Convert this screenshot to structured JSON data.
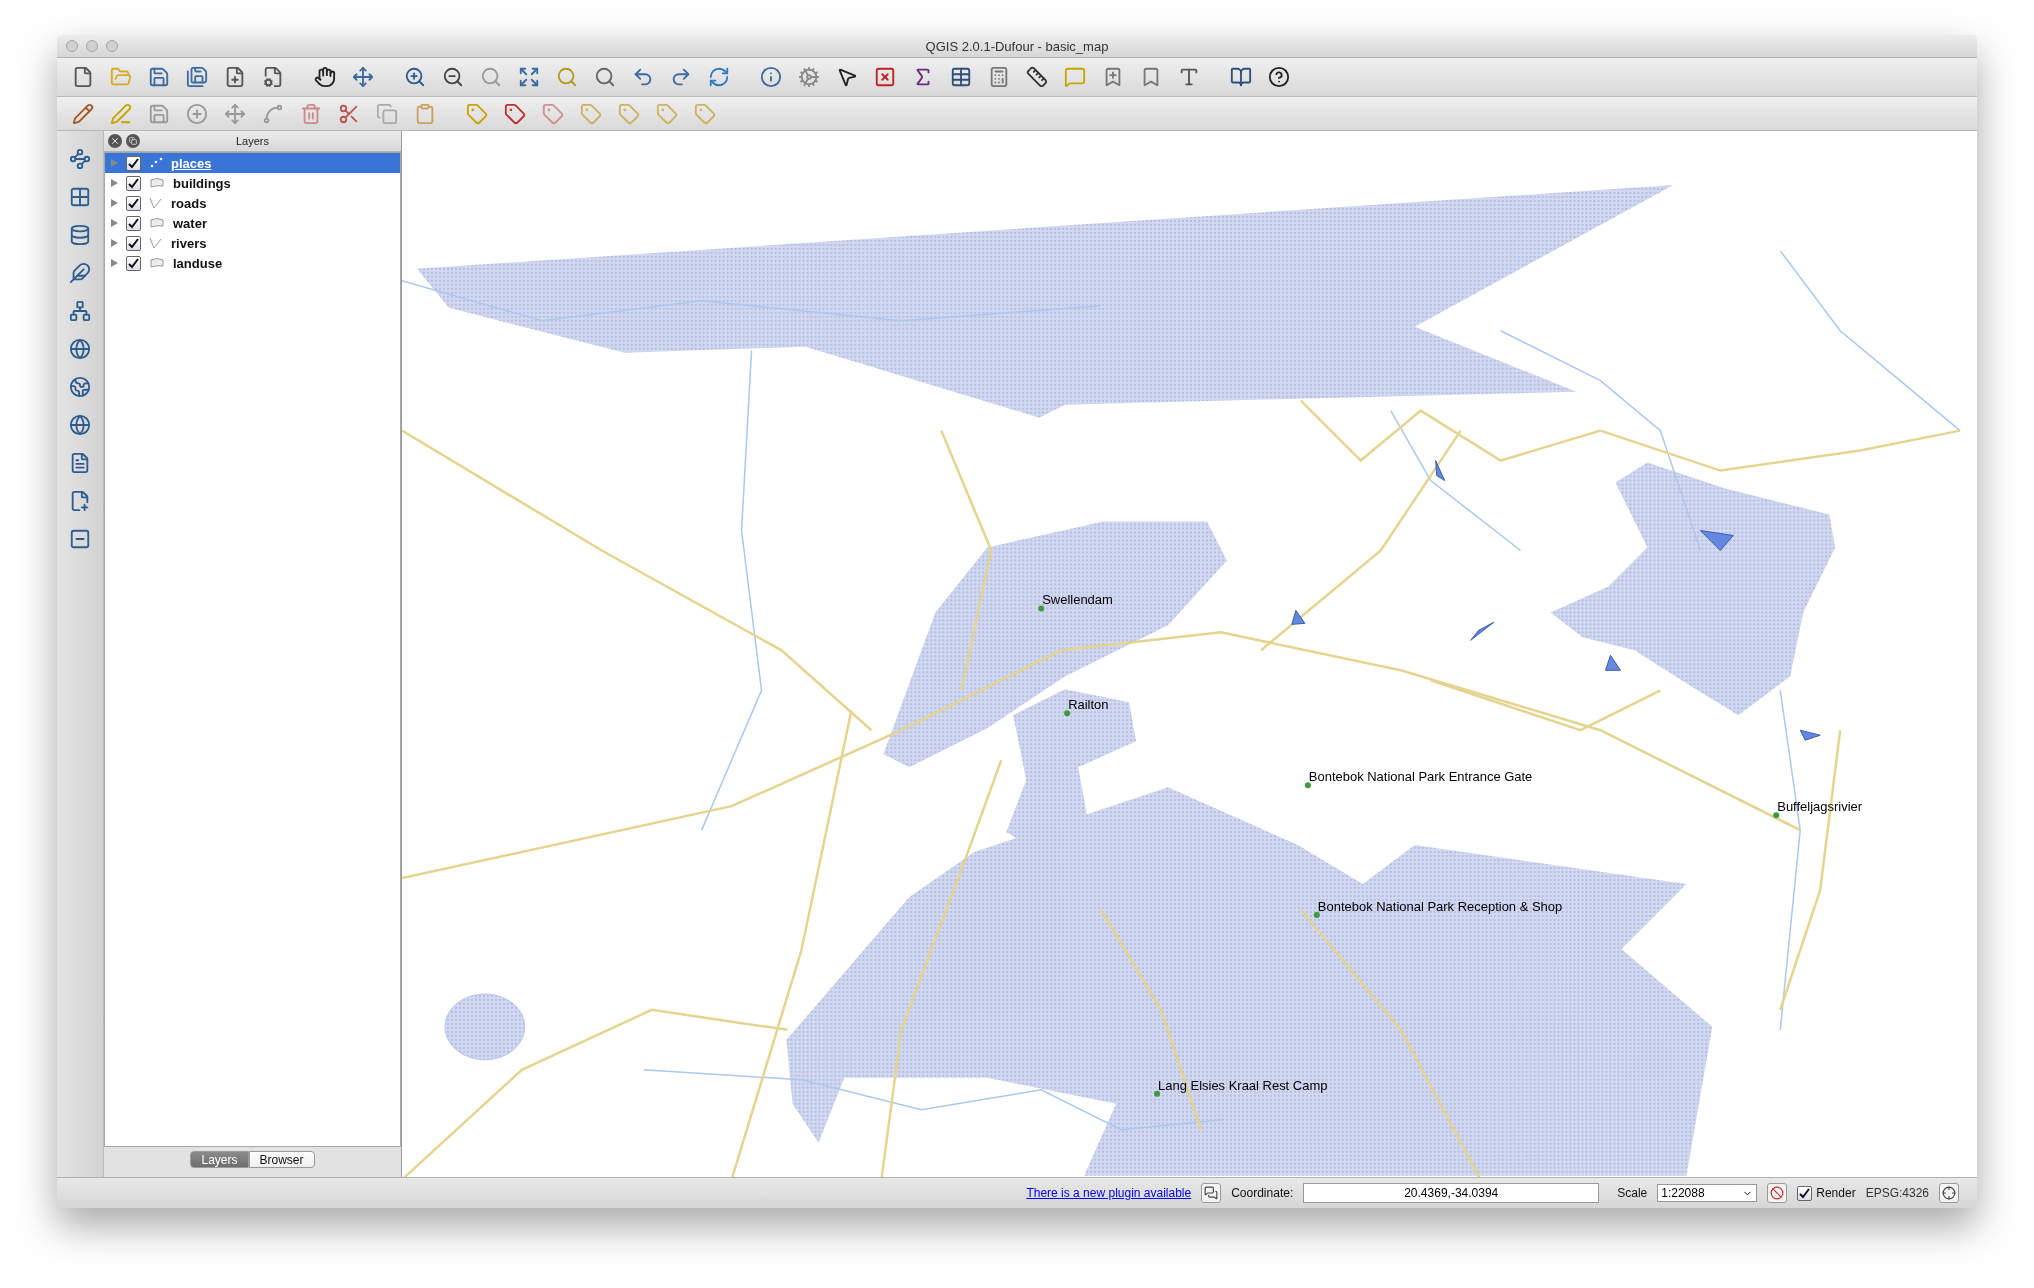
{
  "window": {
    "title": "QGIS 2.0.1-Dufour - basic_map"
  },
  "layers_panel": {
    "title": "Layers",
    "layers": [
      {
        "name": "places",
        "kind": "point",
        "checked": true,
        "selected": true,
        "expanded": false
      },
      {
        "name": "buildings",
        "kind": "polygon",
        "checked": true,
        "selected": false,
        "expanded": false
      },
      {
        "name": "roads",
        "kind": "line",
        "checked": true,
        "selected": false,
        "expanded": false
      },
      {
        "name": "water",
        "kind": "polygon",
        "checked": true,
        "selected": false,
        "expanded": false
      },
      {
        "name": "rivers",
        "kind": "line",
        "checked": true,
        "selected": false,
        "expanded": false
      },
      {
        "name": "landuse",
        "kind": "polygon",
        "checked": true,
        "selected": false,
        "expanded": false
      }
    ]
  },
  "panel_tabs": [
    {
      "label": "Layers",
      "selected": true
    },
    {
      "label": "Browser",
      "selected": false
    }
  ],
  "map": {
    "places": [
      {
        "label": "Swellendam"
      },
      {
        "label": "Railton"
      },
      {
        "label": "Bontebok National Park Entrance Gate"
      },
      {
        "label": "Buffeljagsrivier"
      },
      {
        "label": "Bontebok National Park Reception & Shop"
      },
      {
        "label": "Lang Elsies Kraal Rest Camp"
      }
    ]
  },
  "status_bar": {
    "plugin_notice": "There is a new plugin available",
    "coordinate_label": "Coordinate:",
    "coordinate": "20.4369,-34.0394",
    "scale_label": "Scale",
    "scale": "1:22088",
    "render_label": "Render",
    "render": true,
    "crs": "EPSG:4326"
  }
}
